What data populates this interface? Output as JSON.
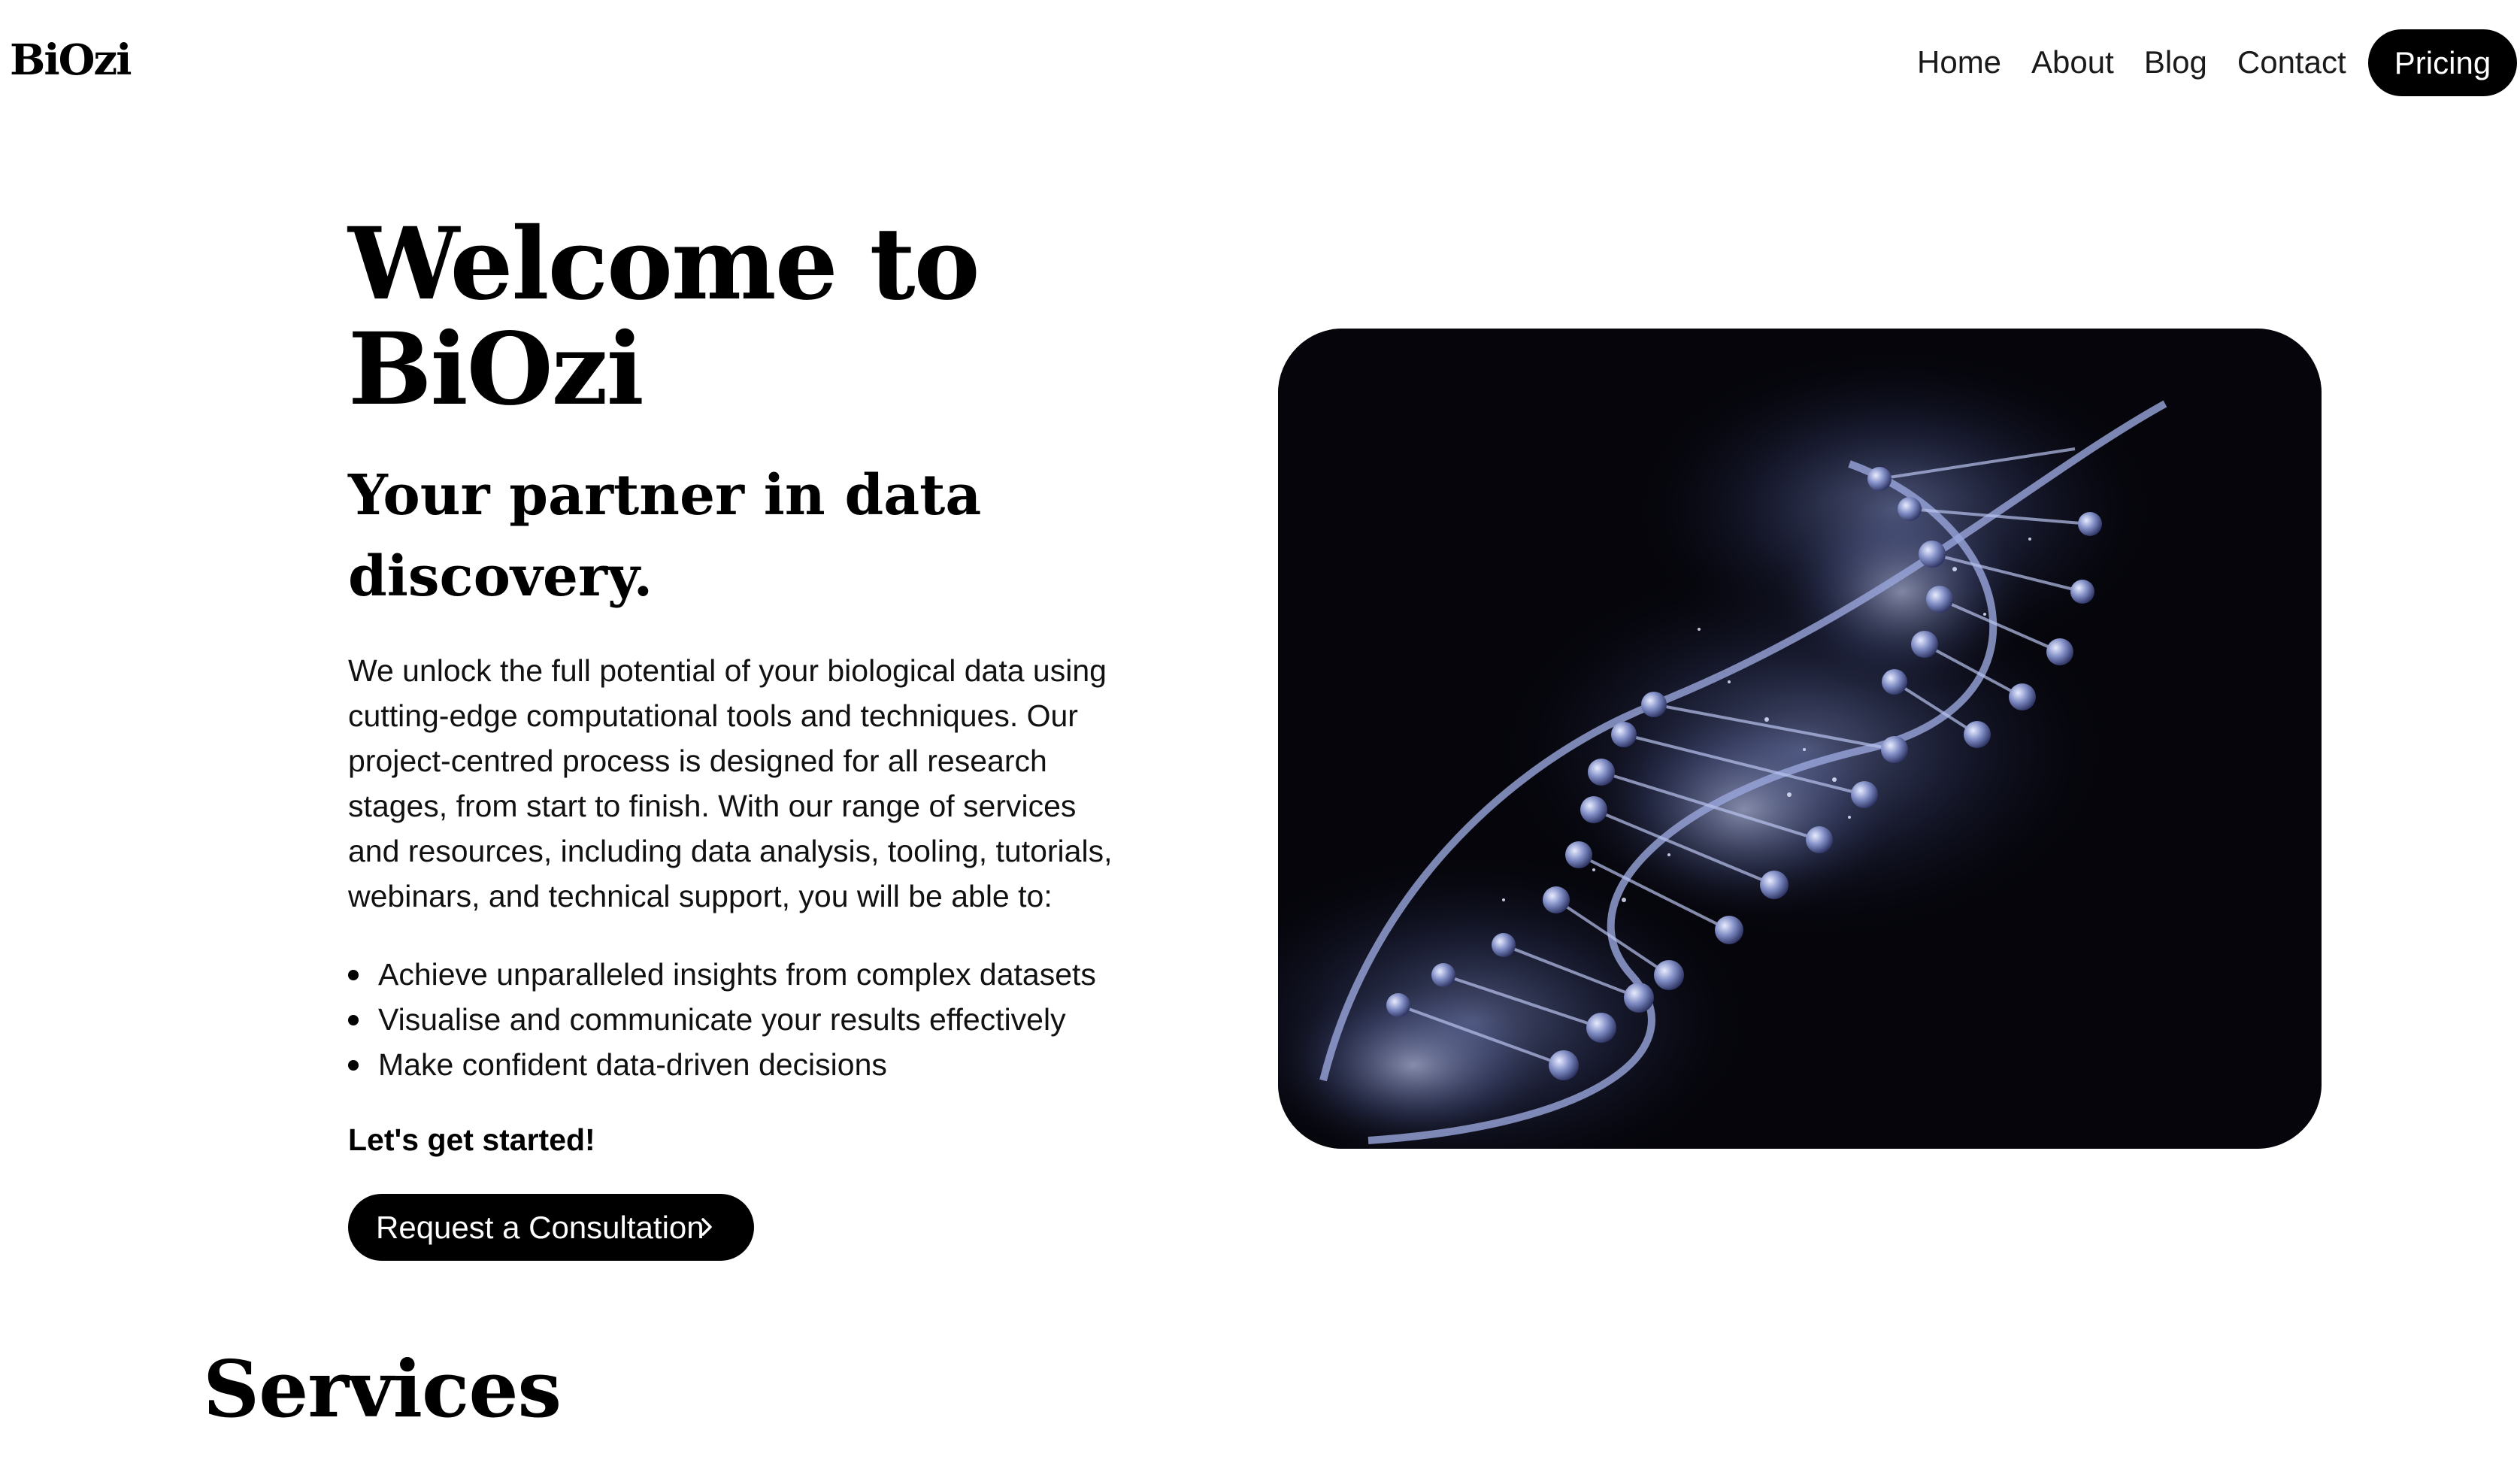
{
  "header": {
    "logo": "BiOzi",
    "nav": [
      "Home",
      "About",
      "Blog",
      "Contact"
    ],
    "pricing_label": "Pricing"
  },
  "hero": {
    "title": "Welcome to BiOzi",
    "subtitle": "Your partner in data discovery.",
    "body": "We unlock the full potential of your biological data using cutting-edge computational tools and techniques. Our project-centred process is designed for all research stages, from start to finish. With our range of services and resources, including data analysis, tooling, tutorials, webinars, and technical support, you will be able to:",
    "bullets": [
      "Achieve unparalleled insights from complex datasets",
      "Visualise and communicate your results effectively",
      "Make confident data-driven decisions"
    ],
    "cta_note": "Let's get started!",
    "cta_label": "Request a Consultation",
    "cta_icon": "chevron-right-icon",
    "image_subject": "dna-helix-illustration"
  },
  "services": {
    "heading": "Services"
  },
  "colors": {
    "button_bg": "#000000",
    "button_text": "#ffffff",
    "image_bg": "#05050b",
    "helix_glow": "#8c9bd8"
  }
}
